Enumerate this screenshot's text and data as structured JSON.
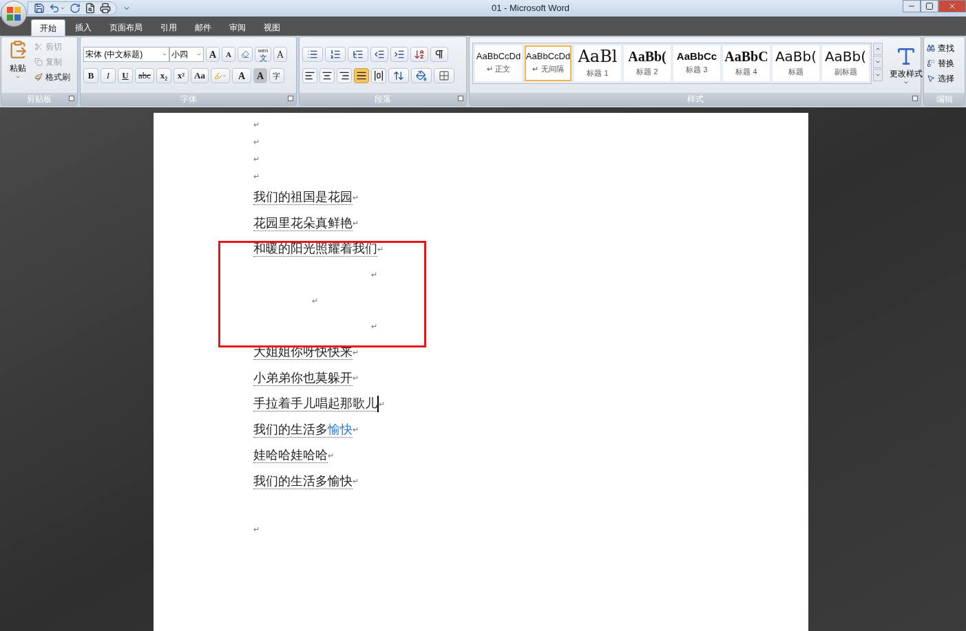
{
  "window": {
    "title": "01 - Microsoft Word"
  },
  "tabs": [
    {
      "label": "开始",
      "selected": true
    },
    {
      "label": "插入",
      "selected": false
    },
    {
      "label": "页面布局",
      "selected": false
    },
    {
      "label": "引用",
      "selected": false
    },
    {
      "label": "邮件",
      "selected": false
    },
    {
      "label": "审阅",
      "selected": false
    },
    {
      "label": "视图",
      "selected": false
    }
  ],
  "clipboard": {
    "label": "剪贴板",
    "paste": "粘贴",
    "items": [
      {
        "label": "剪切",
        "disabled": true
      },
      {
        "label": "复制",
        "disabled": true
      },
      {
        "label": "格式刷",
        "disabled": false
      }
    ]
  },
  "font": {
    "label": "字体",
    "font_name": "宋体 (中文标题)",
    "font_size": "小四",
    "size_buttons": [
      {
        "label": "A",
        "kind": "grow"
      },
      {
        "label": "A",
        "kind": "shrink"
      }
    ],
    "phonetic": {
      "top": "wén",
      "bottom": "文"
    },
    "border_char": "A",
    "format_buttons": [
      {
        "label": "B",
        "kind": "bold"
      },
      {
        "label": "I",
        "kind": "italic"
      },
      {
        "label": "U",
        "kind": "underline"
      },
      {
        "label": "abc",
        "kind": "strike"
      },
      {
        "label": "x₂",
        "kind": "plain"
      },
      {
        "label": "x²",
        "kind": "plain"
      },
      {
        "label": "Aa",
        "kind": "plain"
      }
    ],
    "color_char": "A",
    "shading_char": "A",
    "enclose_char": "字"
  },
  "paragraph": {
    "label": "段落",
    "alignments": [
      {
        "kind": "left",
        "selected": false
      },
      {
        "kind": "center",
        "selected": false
      },
      {
        "kind": "right",
        "selected": false
      },
      {
        "kind": "justify",
        "selected": true
      },
      {
        "kind": "distributed",
        "selected": false
      }
    ]
  },
  "styles": {
    "label": "样式",
    "change_styles": "更改样式",
    "items": [
      {
        "preview": "AaBbCcDd",
        "label": "↵ 正文",
        "kind": "small",
        "selected": false
      },
      {
        "preview": "AaBbCcDd",
        "label": "↵ 无间隔",
        "kind": "small",
        "selected": true
      },
      {
        "preview": "AaBl",
        "label": "标题 1",
        "kind": "serif",
        "selected": false
      },
      {
        "preview": "AaBb(",
        "label": "标题 2",
        "kind": "bold",
        "selected": false
      },
      {
        "preview": "AaBbCc",
        "label": "标题 3",
        "kind": "medium",
        "selected": false
      },
      {
        "preview": "AaBbC",
        "label": "标题 4",
        "kind": "bold",
        "selected": false
      },
      {
        "preview": "AaBb(",
        "label": "标题",
        "kind": "large",
        "selected": false
      },
      {
        "preview": "AaBb(",
        "label": "副标题",
        "kind": "large",
        "selected": false
      }
    ]
  },
  "editing": {
    "label": "编辑",
    "items": [
      "查找",
      "替换",
      "选择"
    ]
  },
  "document": {
    "paragraphs": [
      {
        "kind": "blank",
        "mark": "↵"
      },
      {
        "kind": "blank",
        "mark": "↵"
      },
      {
        "kind": "blank",
        "mark": "↵"
      },
      {
        "kind": "blank",
        "mark": "↵"
      },
      {
        "kind": "text",
        "segments": [
          {
            "text": "我们的祖国是花园"
          }
        ],
        "mark": "↵",
        "cursor": false
      },
      {
        "kind": "text",
        "segments": [
          {
            "text": "花园里花朵真鲜艳"
          }
        ],
        "mark": "↵",
        "cursor": false
      },
      {
        "kind": "text",
        "segments": [
          {
            "text": "和暖的阳光照耀着我们"
          }
        ],
        "mark": "↵",
        "cursor": false
      },
      {
        "kind": "right_mark",
        "mark": "↵"
      },
      {
        "kind": "center_mark",
        "mark": "↵"
      },
      {
        "kind": "right_mark",
        "mark": "↵"
      },
      {
        "kind": "text",
        "segments": [
          {
            "text": "大姐姐你呀快快来"
          }
        ],
        "mark": "↵",
        "cursor": false
      },
      {
        "kind": "text",
        "segments": [
          {
            "text": "小弟弟你也莫躲开"
          }
        ],
        "mark": "↵",
        "cursor": false
      },
      {
        "kind": "text",
        "segments": [
          {
            "text": "手拉着手儿唱起那歌儿"
          }
        ],
        "mark": "↵",
        "cursor": true
      },
      {
        "kind": "text",
        "segments": [
          {
            "text": "我们的生活多"
          },
          {
            "text": "愉快",
            "color": "#2b7bd6"
          }
        ],
        "mark": "↵",
        "cursor": false
      },
      {
        "kind": "text",
        "segments": [
          {
            "text": "娃哈哈娃哈哈"
          }
        ],
        "mark": "↵",
        "cursor": false
      },
      {
        "kind": "text",
        "segments": [
          {
            "text": "我们的生活多愉快"
          }
        ],
        "mark": "↵",
        "cursor": false
      },
      {
        "kind": "tall",
        "mark": "↵"
      }
    ],
    "annotation": {
      "kind": "rectangle",
      "color": "#e8161b"
    }
  }
}
